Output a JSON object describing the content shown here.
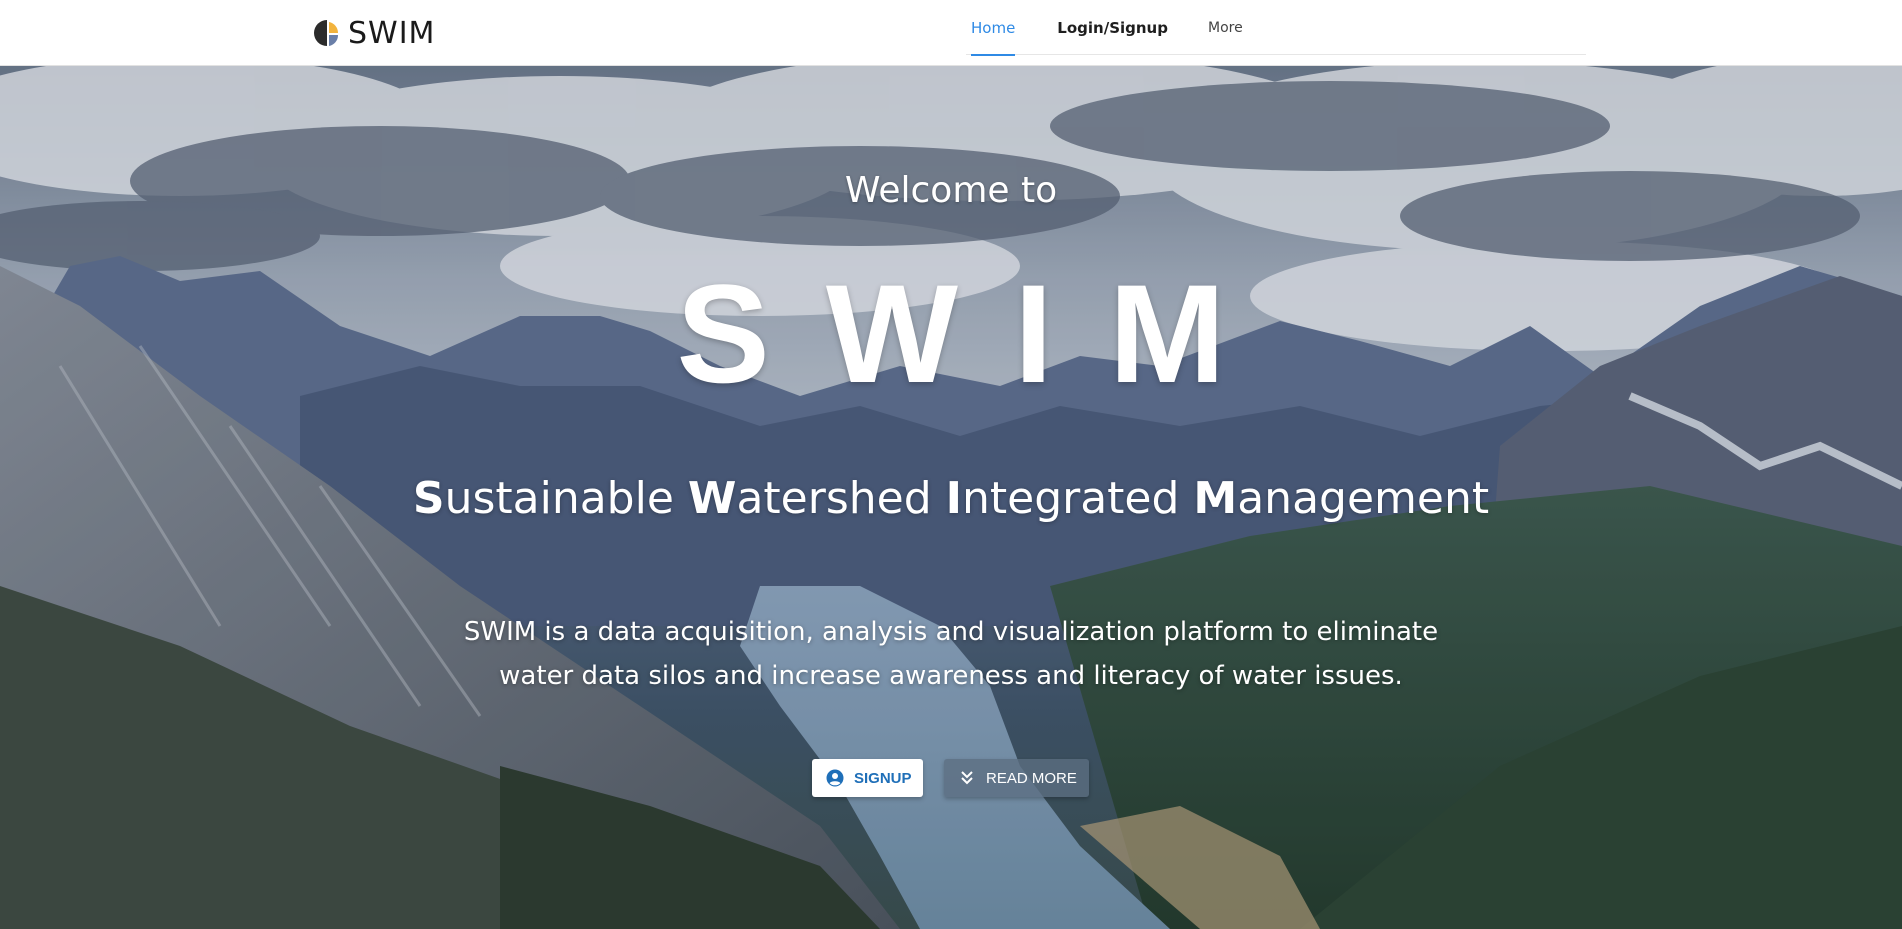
{
  "brand": {
    "name": "SWIM"
  },
  "nav": {
    "items": [
      {
        "label": "Home",
        "active": true
      },
      {
        "label": "Login/Signup",
        "active": false
      },
      {
        "label": "More",
        "active": false
      }
    ]
  },
  "hero": {
    "welcome": "Welcome to",
    "title": "SWIM",
    "subtitle": {
      "parts": [
        {
          "cap": "S",
          "rest": "ustainable "
        },
        {
          "cap": "W",
          "rest": "atershed "
        },
        {
          "cap": "I",
          "rest": "ntegrated "
        },
        {
          "cap": "M",
          "rest": "anagement"
        }
      ]
    },
    "description": "SWIM is a data acquisition, analysis and visualization platform to eliminate water data silos and increase awareness and literacy of water issues.",
    "buttons": {
      "signup": {
        "label": "SIGNUP",
        "icon": "account-circle-icon"
      },
      "read_more": {
        "label": "READ MORE",
        "icon": "chevron-double-down-icon"
      }
    }
  },
  "colors": {
    "accent": "#2f8ae5",
    "signup_text": "#1f6fb8",
    "hero_text": "#ffffff"
  }
}
